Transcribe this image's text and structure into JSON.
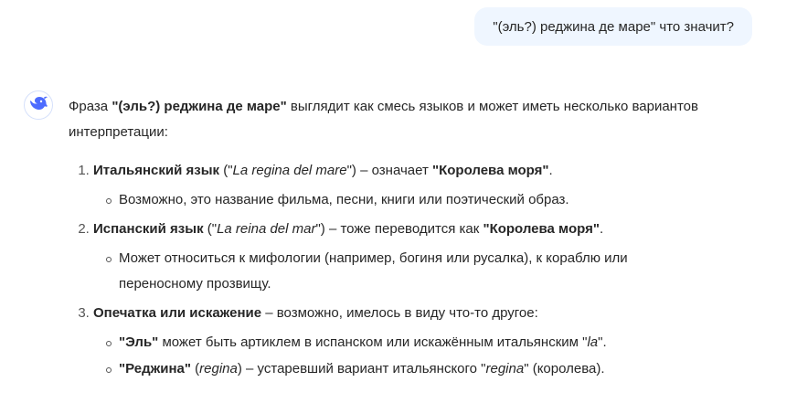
{
  "user_message": {
    "text": "\"(эль?) реджина де маре\" что значит?"
  },
  "assistant": {
    "avatar_icon": "whale-logo-icon",
    "brand_color": "#4d6bfe",
    "intro": {
      "prefix": "Фраза ",
      "phrase": "\"(эль?) реджина де маре\"",
      "suffix": " выглядит как смесь языков и может иметь несколько вариантов интерпретации:"
    },
    "items": [
      {
        "number": "1.",
        "title": "Итальянский язык",
        "open": " (\"",
        "italic": "La regina del mare",
        "close": "\") – означает ",
        "bold_end": "\"Королева моря\"",
        "end": ".",
        "subs": [
          {
            "text": "Возможно, это название фильма, песни, книги или поэтический образ."
          }
        ]
      },
      {
        "number": "2.",
        "title": "Испанский язык",
        "open": " (\"",
        "italic": "La reina del mar",
        "close": "\") – тоже переводится как ",
        "bold_end": "\"Королева моря\"",
        "end": ".",
        "subs": [
          {
            "text": "Может относиться к мифологии (например, богиня или русалка), к кораблю или переносному прозвищу."
          }
        ]
      },
      {
        "number": "3.",
        "title": "Опечатка или искажение",
        "rest": " – возможно, имелось в виду что-то другое:",
        "sub_el": {
          "bold": "\"Эль\"",
          "text": " может быть артиклем в испанском или искажённым итальянским \"",
          "italic": "la",
          "end": "\"."
        },
        "sub_redzhina": {
          "bold": "\"Реджина\"",
          "p1": " (",
          "italic1": "regina",
          "p2": ") – устаревший вариант итальянского \"",
          "italic2": "regina",
          "p3": "\" (королева)."
        }
      }
    ]
  }
}
